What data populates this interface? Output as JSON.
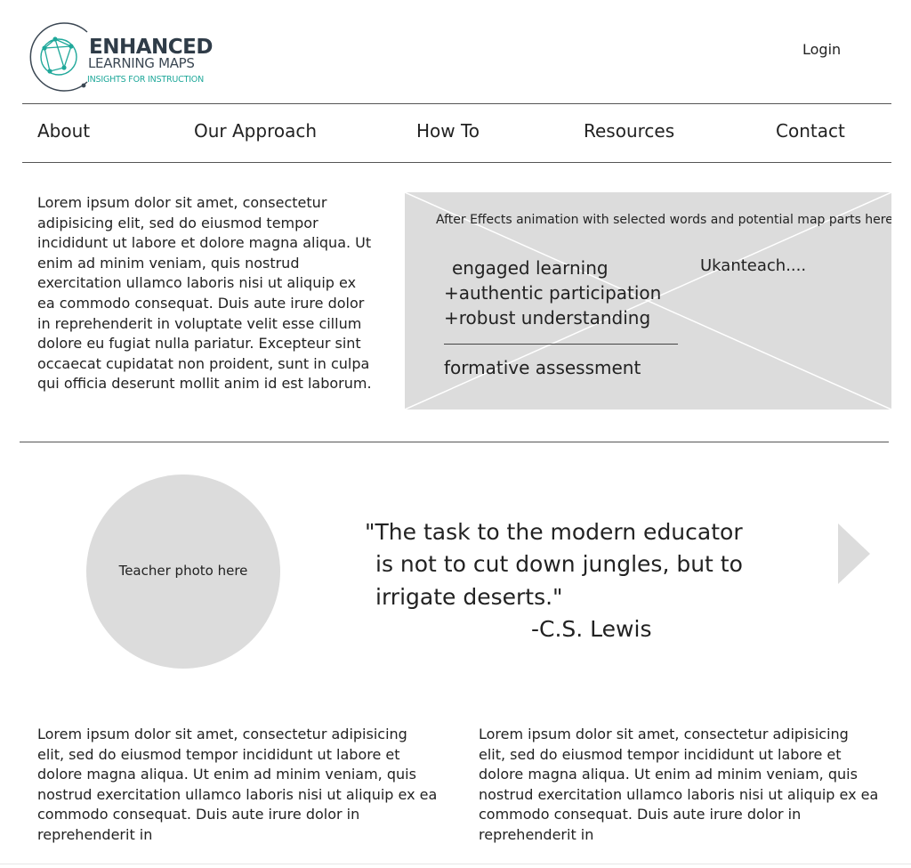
{
  "header": {
    "logo": {
      "line1": "ENHANCED",
      "line2": "LEARNING MAPS",
      "line3": "INSIGHTS FOR INSTRUCTION"
    },
    "login_label": "Login"
  },
  "nav": {
    "items": [
      {
        "label": "About"
      },
      {
        "label": "Our Approach"
      },
      {
        "label": "How To"
      },
      {
        "label": "Resources"
      },
      {
        "label": "Contact"
      }
    ]
  },
  "intro": {
    "text": "Lorem ipsum dolor sit amet, consectetur adipisicing elit, sed do eiusmod tempor incididunt ut labore et dolore magna aliqua. Ut enim ad minim veniam, quis nostrud exercitation ullamco laboris nisi ut aliquip ex ea commodo consequat. Duis aute irure dolor in reprehenderit in voluptate velit esse cillum dolore eu fugiat nulla pariatur. Excepteur sint occaecat cupidatat non proident, sunt in culpa qui officia deserunt mollit anim id est laborum."
  },
  "animation": {
    "caption": "After Effects animation with selected words and potential map parts here",
    "line1": "engaged learning",
    "line2": "+authentic participation",
    "line3": "+robust understanding",
    "line4": "formative assessment",
    "side_text": "Ukanteach...."
  },
  "quote_section": {
    "photo_label": "Teacher photo here",
    "quote_line1": "\"The task to the modern educator",
    "quote_line2": "is not to cut down jungles, but to",
    "quote_line3": "irrigate deserts.\"",
    "attribution": "-C.S. Lewis",
    "next_icon": "triangle-right"
  },
  "columns": {
    "left": "Lorem ipsum dolor sit amet, consectetur adipisicing elit, sed do eiusmod tempor incididunt ut labore et dolore magna aliqua. Ut enim ad minim veniam, quis nostrud exercitation ullamco laboris nisi ut aliquip ex ea commodo consequat. Duis aute irure dolor in reprehenderit in",
    "right": "Lorem ipsum dolor sit amet, consectetur adipisicing elit, sed do eiusmod tempor incididunt ut labore et dolore magna aliqua. Ut enim ad minim veniam, quis nostrud exercitation ullamco laboris nisi ut aliquip ex ea commodo consequat. Duis aute irure dolor in reprehenderit in"
  },
  "colors": {
    "placeholder": "#dcdcdc",
    "logo_dark": "#2f3c48",
    "logo_teal": "#1fa89a"
  }
}
